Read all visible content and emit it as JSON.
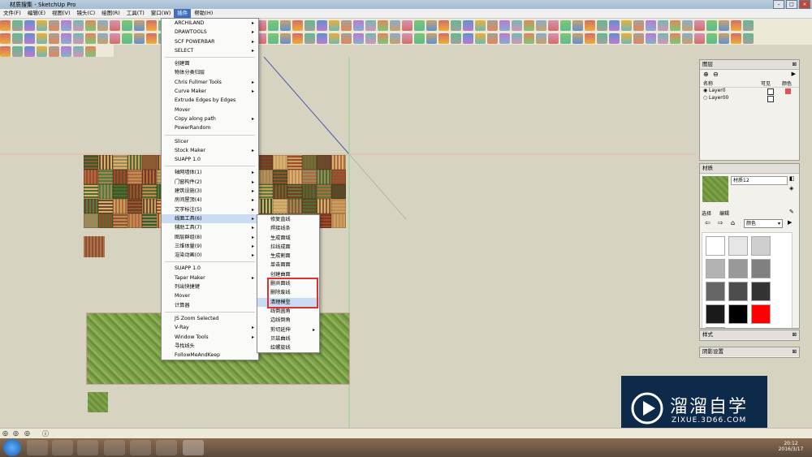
{
  "window": {
    "title": "材质搜集 - SketchUp Pro"
  },
  "menubar": [
    "文件(F)",
    "编辑(E)",
    "视图(V)",
    "镜头(C)",
    "绘图(R)",
    "工具(T)",
    "窗口(W)",
    "插件",
    "帮助(H)"
  ],
  "plugins_menu": {
    "items": [
      {
        "label": "ARCHILAND",
        "sub": true
      },
      {
        "label": "DRAWTOOLS",
        "sub": true
      },
      {
        "label": "SCF POWERBAR",
        "sub": true
      },
      {
        "label": "SELECT",
        "sub": true
      },
      {
        "sep": true
      },
      {
        "label": "创建面"
      },
      {
        "label": "物体分类归层"
      },
      {
        "label": "Chris Fullmer Tools",
        "sub": true
      },
      {
        "label": "Curve Maker",
        "sub": true
      },
      {
        "label": "Extrude Edges by Edges"
      },
      {
        "label": "Mover"
      },
      {
        "label": "Copy along path",
        "sub": true
      },
      {
        "label": "PowerRandom"
      },
      {
        "sep": true
      },
      {
        "label": "Slicer"
      },
      {
        "label": "Stock Maker",
        "sub": true
      },
      {
        "label": "SUAPP 1.0"
      },
      {
        "sep": true
      },
      {
        "label": "轴网墙体(1)",
        "sub": true
      },
      {
        "label": "门窗构件(2)",
        "sub": true
      },
      {
        "label": "建筑设施(3)",
        "sub": true
      },
      {
        "label": "房间屋顶(4)",
        "sub": true
      },
      {
        "label": "文字标注(5)",
        "sub": true
      },
      {
        "label": "线面工具(6)",
        "sub": true,
        "hl": true
      },
      {
        "label": "辅助工具(7)",
        "sub": true
      },
      {
        "label": "图层群组(8)",
        "sub": true
      },
      {
        "label": "三维体量(9)",
        "sub": true
      },
      {
        "label": "渲染动画(0)",
        "sub": true
      },
      {
        "sep": true
      },
      {
        "label": "SUAPP 1.0"
      },
      {
        "label": "Taper Maker",
        "sub": true
      },
      {
        "label": "列出快捷键"
      },
      {
        "label": "Mover"
      },
      {
        "label": "计算器"
      },
      {
        "sep": true
      },
      {
        "label": "JS Zoom Selected"
      },
      {
        "label": "V-Ray",
        "sub": true
      },
      {
        "label": "Window Tools",
        "sub": true
      },
      {
        "label": "寻找线头"
      },
      {
        "label": "FollowMeAndKeep"
      }
    ]
  },
  "submenu": {
    "items": [
      {
        "label": "修复直线"
      },
      {
        "label": "焊接线条"
      },
      {
        "label": "生成面域"
      },
      {
        "label": "拉线成面"
      },
      {
        "label": "生成割面"
      },
      {
        "label": "单击面面"
      },
      {
        "label": "创建曲面"
      },
      {
        "label": "删共面线",
        "boxed": true
      },
      {
        "label": "删除废线",
        "boxed": true
      },
      {
        "label": "清理模型",
        "boxed": true,
        "hl": true
      },
      {
        "label": "线倒圆角"
      },
      {
        "label": "边线倒角"
      },
      {
        "label": "剪切延伸",
        "sub": true
      },
      {
        "label": "贝兹曲线"
      },
      {
        "label": "绘螺旋线"
      }
    ]
  },
  "layers_panel": {
    "title": "图层",
    "col_name": "名称",
    "col_visible": "可见",
    "col_color": "颜色",
    "rows": [
      {
        "name": "Layer0",
        "color": "#e85050"
      },
      {
        "name": "Layer00",
        "color": ""
      }
    ]
  },
  "materials_panel": {
    "title": "材质",
    "material_name": "材质12",
    "tab_select": "选择",
    "tab_edit": "编辑",
    "category": "颜色",
    "swatches": [
      "#ffffff",
      "#e6e6e6",
      "#cfcfcf",
      "#b3b3b3",
      "#999999",
      "#808080",
      "#666666",
      "#4d4d4d",
      "#333333",
      "#1a1a1a",
      "#000000",
      "#ff0000",
      "#ff2020"
    ]
  },
  "style_panel": {
    "title": "样式"
  },
  "shadow_panel": {
    "title": "阴影设置"
  },
  "watermark": {
    "brand": "溜溜自学",
    "url": "ZIXUE.3D66.COM"
  },
  "clock": {
    "time": "20:12",
    "date": "2016/3/17"
  }
}
